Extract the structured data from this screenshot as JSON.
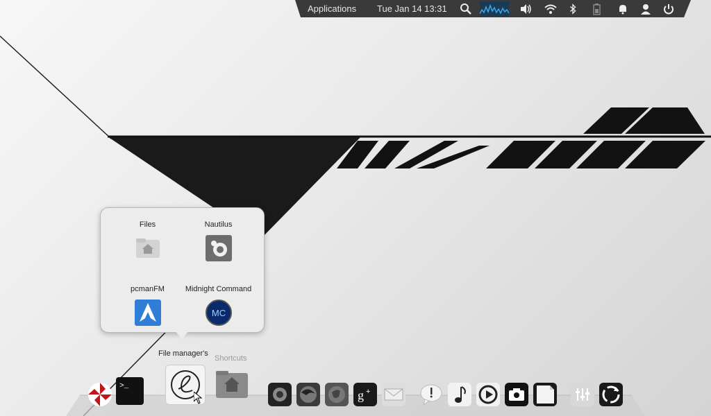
{
  "top_panel": {
    "applications_label": "Applications",
    "clock": "Tue Jan 14 13:31",
    "tray_icons": [
      "search-icon",
      "audio-visualizer",
      "volume-icon",
      "wifi-icon",
      "bluetooth-icon",
      "battery-icon",
      "notification-icon",
      "user-icon",
      "power-icon"
    ]
  },
  "popup": {
    "items": [
      {
        "label": "Files",
        "icon": "home-folder-icon"
      },
      {
        "label": "Nautilus",
        "icon": "nautilus-icon"
      },
      {
        "label": "pcmanFM",
        "icon": "pcmanfm-icon"
      },
      {
        "label": "Midnight Command",
        "icon": "midnight-commander-icon"
      }
    ],
    "folder_title": "File manager's"
  },
  "dock": {
    "shortcuts_label": "Shortcuts",
    "items": [
      "umbrella-icon",
      "terminal-icon",
      "elementary-icon",
      "shortcuts-folder-icon",
      "screenshot-icon",
      "firefox-icon",
      "browser-icon",
      "google-plus-icon",
      "mail-icon",
      "notes-icon",
      "music-icon",
      "video-icon",
      "camera-icon",
      "document-icon",
      "equalizer-icon",
      "recycle-icon"
    ]
  },
  "colors": {
    "panel": "#3a3a3a",
    "accent_blue": "#2f7fd6"
  }
}
